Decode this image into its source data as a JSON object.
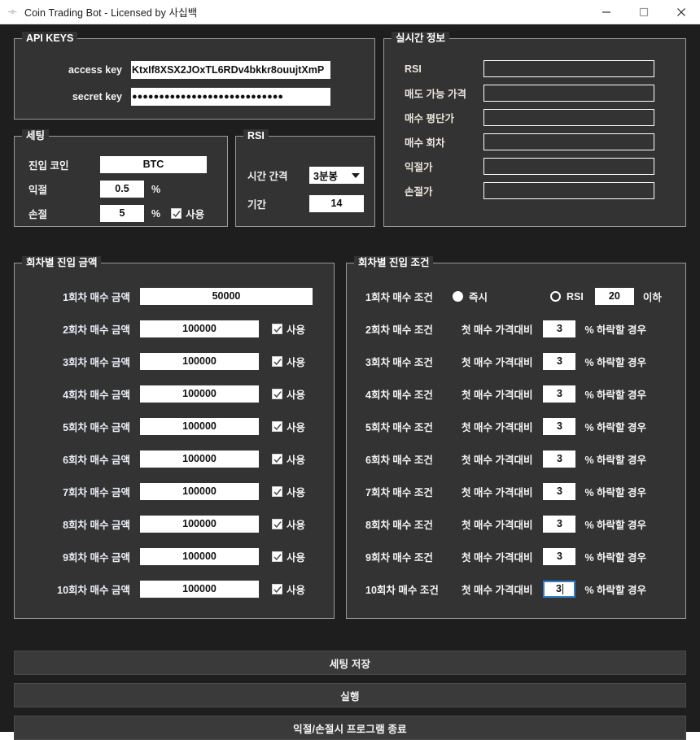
{
  "window": {
    "title": "Coin Trading Bot - Licensed by 사십백",
    "icon": "app-icon",
    "controls": {
      "minimize": "minimize-icon",
      "maximize": "maximize-icon",
      "close": "close-icon"
    }
  },
  "api_keys": {
    "legend": "API KEYS",
    "access_key_label": "access key",
    "access_key_value": "KtxIf8XSX2JOxTL6RDv4bkkr8ouujtXmP",
    "secret_key_label": "secret key",
    "secret_key_value": "●●●●●●●●●●●●●●●●●●●●●●●●●●●●"
  },
  "setting": {
    "legend": "세팅",
    "coin_label": "진입 코인",
    "coin_value": "BTC",
    "take_profit_label": "익절",
    "take_profit_value": "0.5",
    "take_profit_unit": "%",
    "stop_loss_label": "손절",
    "stop_loss_value": "5",
    "stop_loss_unit": "%",
    "stop_loss_use_label": "사용",
    "stop_loss_use_checked": true
  },
  "rsi": {
    "legend": "RSI",
    "interval_label": "시간 간격",
    "interval_value": "3분봉",
    "interval_options": [
      "3분봉"
    ],
    "period_label": "기간",
    "period_value": "14"
  },
  "realtime": {
    "legend": "실시간 정보",
    "rows": [
      {
        "label": "RSI",
        "value": ""
      },
      {
        "label": "매도 가능 가격",
        "value": ""
      },
      {
        "label": "매수 평단가",
        "value": ""
      },
      {
        "label": "매수 회차",
        "value": ""
      },
      {
        "label": "익절가",
        "value": ""
      },
      {
        "label": "손절가",
        "value": ""
      }
    ]
  },
  "entry_amount": {
    "legend": "회차별 진입 금액",
    "use_label": "사용",
    "rows": [
      {
        "label": "1회차 매수 금액",
        "value": "50000",
        "has_use": false,
        "use_checked": false
      },
      {
        "label": "2회차 매수 금액",
        "value": "100000",
        "has_use": true,
        "use_checked": true
      },
      {
        "label": "3회차 매수 금액",
        "value": "100000",
        "has_use": true,
        "use_checked": true
      },
      {
        "label": "4회차 매수 금액",
        "value": "100000",
        "has_use": true,
        "use_checked": true
      },
      {
        "label": "5회차 매수 금액",
        "value": "100000",
        "has_use": true,
        "use_checked": true
      },
      {
        "label": "6회차 매수 금액",
        "value": "100000",
        "has_use": true,
        "use_checked": true
      },
      {
        "label": "7회차 매수 금액",
        "value": "100000",
        "has_use": true,
        "use_checked": true
      },
      {
        "label": "8회차 매수 금액",
        "value": "100000",
        "has_use": true,
        "use_checked": true
      },
      {
        "label": "9회차 매수 금액",
        "value": "100000",
        "has_use": true,
        "use_checked": true
      },
      {
        "label": "10회차 매수 금액",
        "value": "100000",
        "has_use": true,
        "use_checked": true
      }
    ]
  },
  "entry_condition": {
    "legend": "회차별 진입 조건",
    "first_row": {
      "label": "1회차 매수 조건",
      "radio_immediate_label": "즉시",
      "radio_immediate_selected": true,
      "radio_rsi_label": "RSI",
      "radio_rsi_selected": false,
      "rsi_value": "20",
      "suffix": "이하"
    },
    "prefix": "첫 매수 가격대비",
    "suffix": "% 하락할 경우",
    "rows": [
      {
        "label": "2회차 매수 조건",
        "value": "3",
        "focused": false
      },
      {
        "label": "3회차 매수 조건",
        "value": "3",
        "focused": false
      },
      {
        "label": "4회차 매수 조건",
        "value": "3",
        "focused": false
      },
      {
        "label": "5회차 매수 조건",
        "value": "3",
        "focused": false
      },
      {
        "label": "6회차 매수 조건",
        "value": "3",
        "focused": false
      },
      {
        "label": "7회차 매수 조건",
        "value": "3",
        "focused": false
      },
      {
        "label": "8회차 매수 조건",
        "value": "3",
        "focused": false
      },
      {
        "label": "9회차 매수 조건",
        "value": "3",
        "focused": false
      },
      {
        "label": "10회차 매수 조건",
        "value": "3",
        "focused": true
      }
    ]
  },
  "actions": {
    "save": "세팅 저장",
    "run": "실행",
    "exit": "익절/손절시 프로그램 종료"
  },
  "colors": {
    "app_background": "#1e1e1e",
    "group_background": "#333333",
    "group_border": "#9a9a9a",
    "label_warm": "#ece4da",
    "label_cool": "#eaeef8",
    "input_background": "#ffffff",
    "focus_border": "#2f7fd1",
    "button_background": "#3a3a3a"
  }
}
